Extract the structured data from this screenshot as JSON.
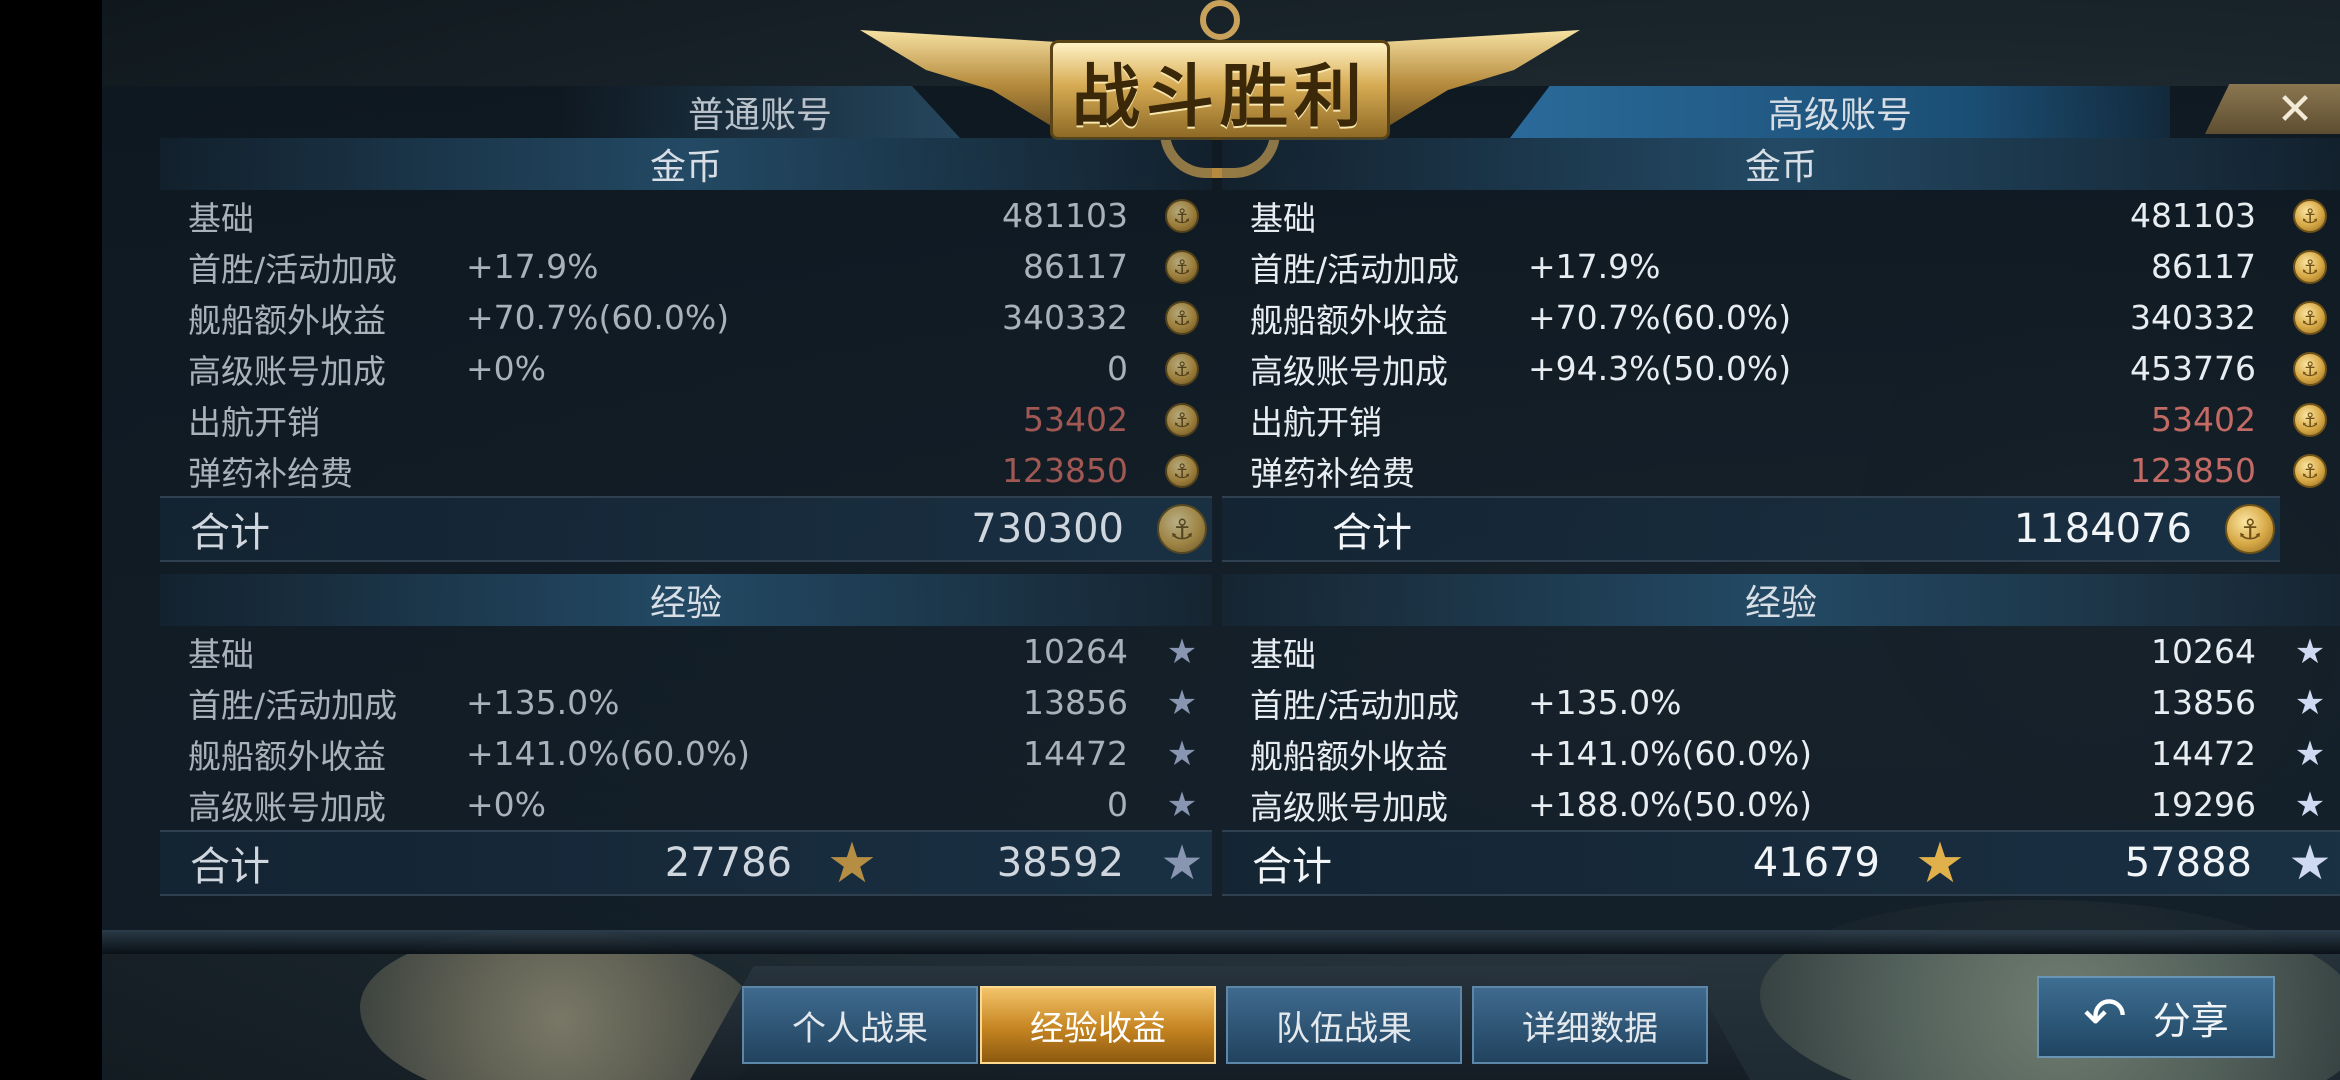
{
  "header": {
    "title": "战斗胜利",
    "tab_normal": "普通账号",
    "tab_premium": "高级账号",
    "close_icon": "close-icon",
    "close_glyph": "✕"
  },
  "left": {
    "coins": {
      "heading": "金币",
      "rows": [
        {
          "label": "基础",
          "pct": "",
          "value": "481103"
        },
        {
          "label": "首胜/活动加成",
          "pct": "+17.9%",
          "value": "86117"
        },
        {
          "label": "舰船额外收益",
          "pct": "+70.7%(60.0%)",
          "value": "340332"
        },
        {
          "label": "高级账号加成",
          "pct": "+0%",
          "value": "0"
        },
        {
          "label": "出航开销",
          "pct": "",
          "value": "53402",
          "negative": true
        },
        {
          "label": "弹药补给费",
          "pct": "",
          "value": "123850",
          "negative": true
        }
      ],
      "total_label": "合计",
      "total": "730300"
    },
    "exp": {
      "heading": "经验",
      "rows": [
        {
          "label": "基础",
          "pct": "",
          "value": "10264"
        },
        {
          "label": "首胜/活动加成",
          "pct": "+135.0%",
          "value": "13856"
        },
        {
          "label": "舰船额外收益",
          "pct": "+141.0%(60.0%)",
          "value": "14472"
        },
        {
          "label": "高级账号加成",
          "pct": "+0%",
          "value": "0"
        }
      ],
      "total_label": "合计",
      "total_captain": "27786",
      "total": "38592"
    }
  },
  "right": {
    "coins": {
      "heading": "金币",
      "rows": [
        {
          "label": "基础",
          "pct": "",
          "value": "481103"
        },
        {
          "label": "首胜/活动加成",
          "pct": "+17.9%",
          "value": "86117"
        },
        {
          "label": "舰船额外收益",
          "pct": "+70.7%(60.0%)",
          "value": "340332"
        },
        {
          "label": "高级账号加成",
          "pct": "+94.3%(50.0%)",
          "value": "453776"
        },
        {
          "label": "出航开销",
          "pct": "",
          "value": "53402",
          "negative": true
        },
        {
          "label": "弹药补给费",
          "pct": "",
          "value": "123850",
          "negative": true
        }
      ],
      "total_label": "合计",
      "total": "1184076"
    },
    "exp": {
      "heading": "经验",
      "rows": [
        {
          "label": "基础",
          "pct": "",
          "value": "10264"
        },
        {
          "label": "首胜/活动加成",
          "pct": "+135.0%",
          "value": "13856"
        },
        {
          "label": "舰船额外收益",
          "pct": "+141.0%(60.0%)",
          "value": "14472"
        },
        {
          "label": "高级账号加成",
          "pct": "+188.0%(50.0%)",
          "value": "19296"
        }
      ],
      "total_label": "合计",
      "total_captain": "41679",
      "total": "57888"
    }
  },
  "nav": {
    "tabs": [
      {
        "label": "个人战果",
        "active": false
      },
      {
        "label": "经验收益",
        "active": true
      },
      {
        "label": "队伍战果",
        "active": false
      },
      {
        "label": "详细数据",
        "active": false
      }
    ],
    "share_label": "分享",
    "share_icon": "share-arrow-icon"
  },
  "icons": {
    "coin": "coin-icon",
    "star": "star-icon",
    "captain_star": "captain-star-icon"
  },
  "colors": {
    "accent_gold": "#e0b04a",
    "negative_red": "#c46a64",
    "active_tab": "#c58421",
    "panel_blue": "#24506f"
  }
}
